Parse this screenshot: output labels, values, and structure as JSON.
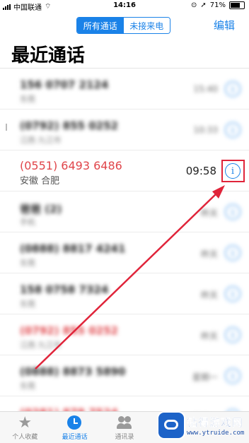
{
  "status_bar": {
    "carrier": "中国联通",
    "time": "14:16",
    "battery": "71%"
  },
  "segment": {
    "all_calls": "所有通话",
    "missed_calls": "未接来电"
  },
  "edit_label": "编辑",
  "title": "最近通话",
  "calls": [
    {
      "number": "156 0707 2124",
      "location": "东莞",
      "time": "15:40",
      "missed": false,
      "blurred": true
    },
    {
      "number": "(0792) 855 0252",
      "location": "江西 九江市",
      "time": "10:33",
      "missed": false,
      "blurred": true
    },
    {
      "number": "(0551) 6493 6486",
      "location": "安徽 合肥",
      "time": "09:58",
      "missed": true,
      "blurred": false,
      "highlighted": true
    },
    {
      "number": "爸爸 (2)",
      "location": "手机",
      "time": "昨天",
      "missed": false,
      "blurred": true
    },
    {
      "number": "(0888) 8817 4241",
      "location": "东莞",
      "time": "昨天",
      "missed": false,
      "blurred": true
    },
    {
      "number": "158 0758 7324",
      "location": "东莞",
      "time": "昨天",
      "missed": false,
      "blurred": true
    },
    {
      "number": "(0792) 855 0252",
      "location": "江西 九江市",
      "time": "昨天",
      "missed": true,
      "blurred": true
    },
    {
      "number": "(0888) 8873 5890",
      "location": "东莞",
      "time": "星期一",
      "missed": false,
      "blurred": true
    },
    {
      "number": "(0281) 878 7524",
      "location": "东莞",
      "time": "星期一",
      "missed": true,
      "blurred": true
    }
  ],
  "info_glyph": "i",
  "tabs": [
    {
      "label": "个人收藏",
      "icon": "star-icon"
    },
    {
      "label": "最近通话",
      "icon": "clock-icon"
    },
    {
      "label": "通讯录",
      "icon": "contacts-icon"
    }
  ],
  "watermark": {
    "name": "钻得游戏网",
    "url": "www.ytruide.com"
  },
  "colors": {
    "accent": "#1a82e8",
    "missed": "#e0454a",
    "annotation": "#e0243a"
  }
}
